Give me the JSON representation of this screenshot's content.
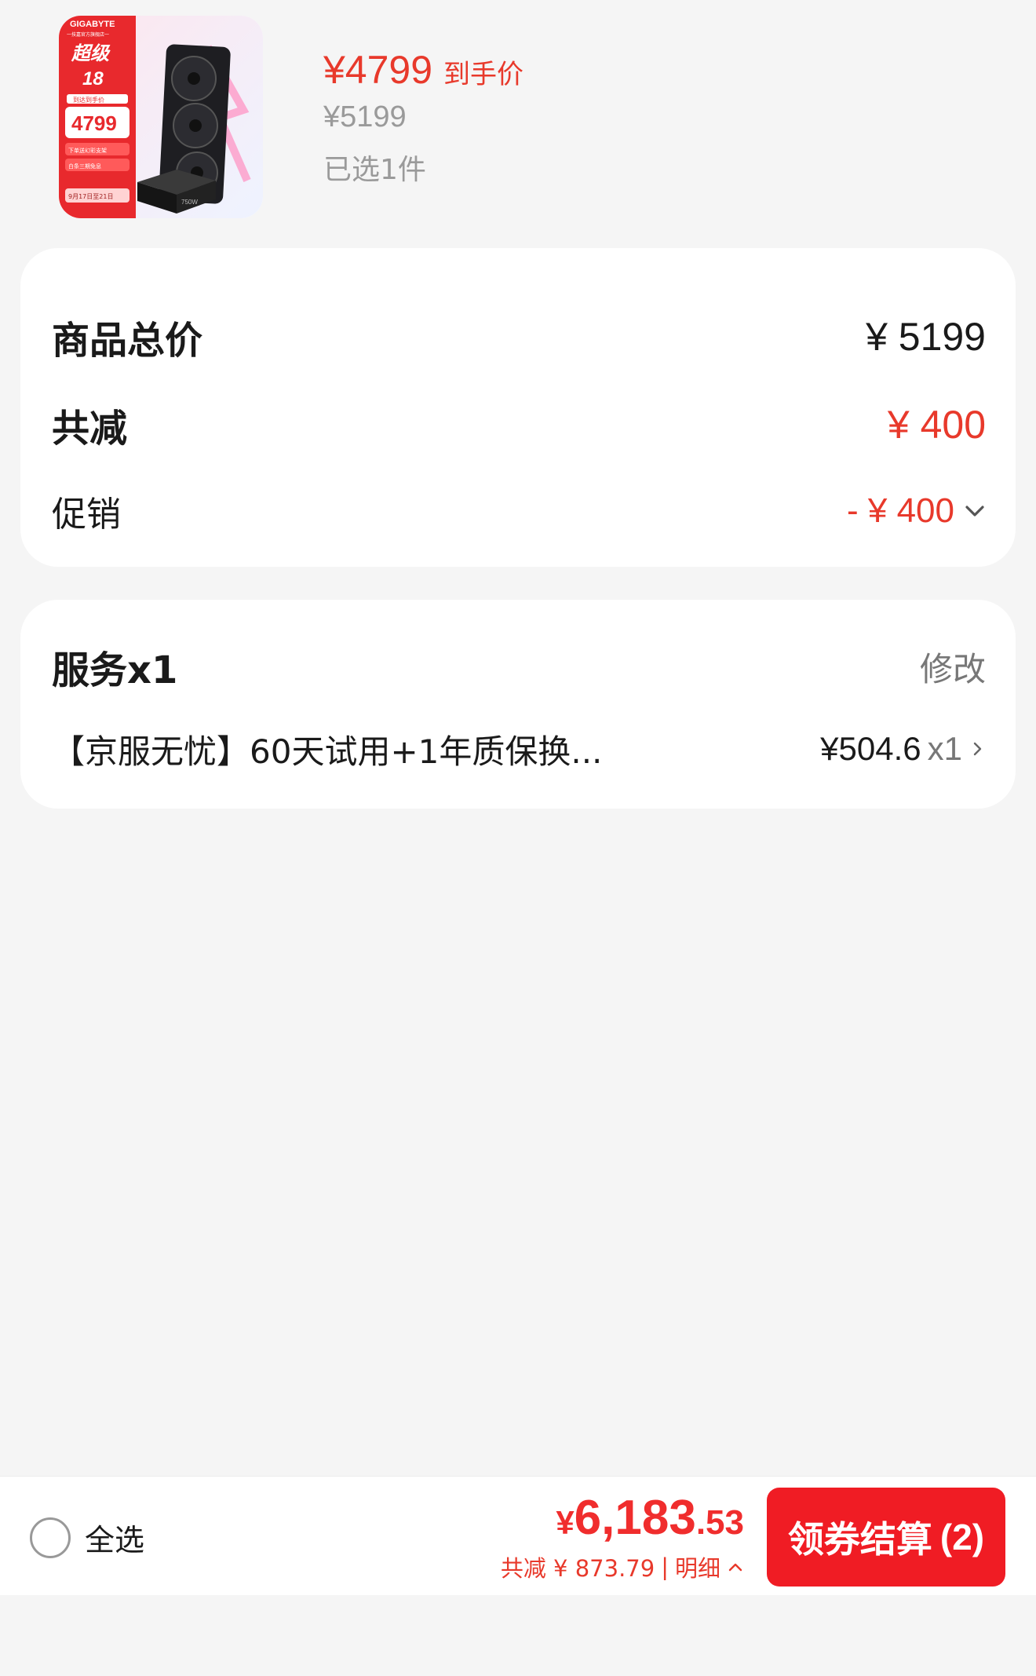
{
  "product": {
    "thumb": {
      "brand": "GIGABYTE",
      "store": "一技嘉官方旗舰店一",
      "event_line1": "超级",
      "event_line2": "18",
      "banner_tag": "到达到手价",
      "banner_price": "4799",
      "perk1": "下单送幻彩支架",
      "perk2": "白条三期免息",
      "dates": "9月17日至21日",
      "psu_label": "750W"
    },
    "final_price": "¥4799",
    "final_price_tag": "到手价",
    "original_price": "¥5199",
    "selected_count": "已选1件"
  },
  "price_card": {
    "total_label": "商品总价",
    "total_value": "¥ 5199",
    "discount_label": "共减",
    "discount_value": "¥ 400",
    "promo_label": "促销",
    "promo_value": "- ¥ 400"
  },
  "service_card": {
    "title": "服务x1",
    "edit_label": "修改",
    "item_name": "【京服无忧】60天试用+1年质保换...",
    "item_price": "¥504.6",
    "item_qty": "x1"
  },
  "bottom_bar": {
    "select_all_label": "全选",
    "total_symbol": "¥",
    "total_integer": "6,183",
    "total_decimal": ".53",
    "saved_label": "共减 ¥ 873.79",
    "separator": "|",
    "detail_label": "明细",
    "checkout_label": "领券结算",
    "checkout_count": "(2)"
  },
  "colors": {
    "accent_red": "#e8392b",
    "button_red": "#f01c24",
    "muted_gray": "#9a9a9a"
  }
}
